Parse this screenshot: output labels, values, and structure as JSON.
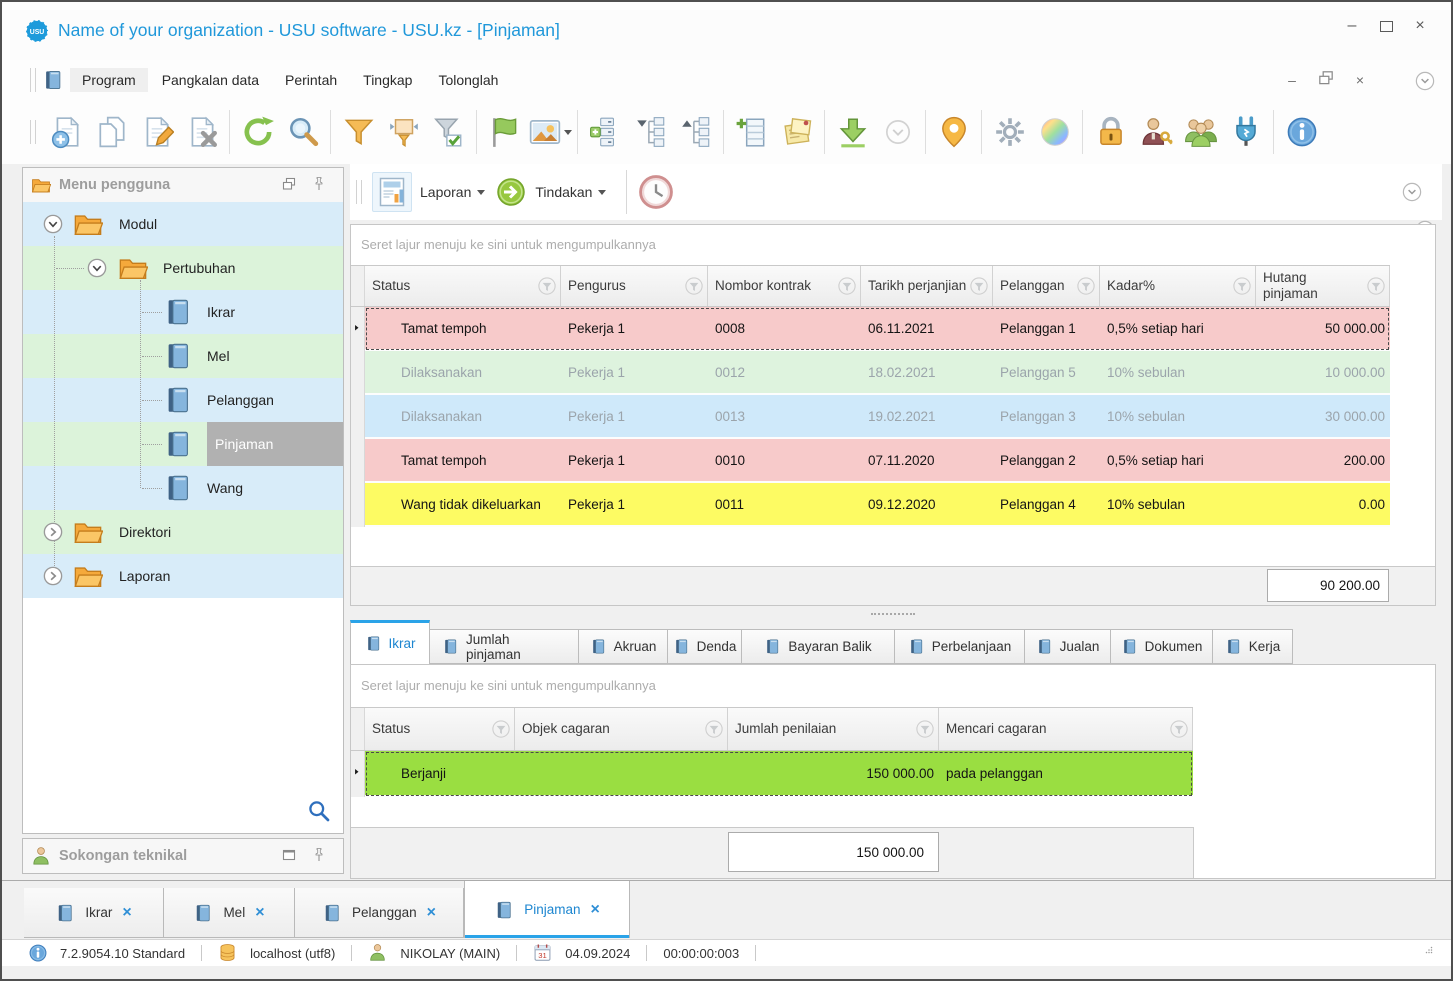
{
  "window": {
    "title": "Name of your organization - USU software - USU.kz - [Pinjaman]",
    "logo_text": "USU",
    "controls": {
      "minimize": "–",
      "close": "×"
    }
  },
  "menu_bar": {
    "active_item": "Program",
    "items": [
      "Program",
      "Pangkalan data",
      "Perintah",
      "Tingkap",
      "Tolonglah"
    ]
  },
  "toolbar": {
    "buttons": [
      "add-record",
      "copy-record",
      "edit-record",
      "delete-record",
      "|",
      "refresh",
      "search",
      "|",
      "filter",
      "filter-custom",
      "filter-checked",
      "|",
      "flag",
      "image+",
      "|",
      "expand-groups",
      "collapse-tree",
      "expand-tree",
      "|",
      "add-column",
      "notes",
      "|",
      "export",
      "chevron-mini",
      "|",
      "location",
      "|",
      "settings",
      "palette",
      "|",
      "lock",
      "user-key",
      "users",
      "plug",
      "|",
      "info"
    ]
  },
  "actions_bar": {
    "report_label": "Laporan",
    "action_label": "Tindakan"
  },
  "sidebar": {
    "title": "Menu pengguna",
    "support_title": "Sokongan teknikal",
    "tree": [
      {
        "label": "Modul",
        "level": 0,
        "icon": "folder",
        "expander": "down"
      },
      {
        "label": "Pertubuhan",
        "level": 1,
        "icon": "folder",
        "expander": "down"
      },
      {
        "label": "Ikrar",
        "level": 2,
        "icon": "book"
      },
      {
        "label": "Mel",
        "level": 2,
        "icon": "book"
      },
      {
        "label": "Pelanggan",
        "level": 2,
        "icon": "book"
      },
      {
        "label": "Pinjaman",
        "level": 2,
        "icon": "book",
        "selected": true
      },
      {
        "label": "Wang",
        "level": 2,
        "icon": "book"
      },
      {
        "label": "Direktori",
        "level": 0,
        "icon": "folder",
        "expander": "right"
      },
      {
        "label": "Laporan",
        "level": 0,
        "icon": "folder",
        "expander": "right"
      }
    ]
  },
  "main_grid": {
    "group_panel_text": "Seret lajur menuju ke sini untuk mengumpulkannya",
    "columns": [
      "Status",
      "Pengurus",
      "Nombor kontrak",
      "Tarikh perjanjian",
      "Pelanggan",
      "Kadar%",
      "Hutang pinjaman"
    ],
    "rows": [
      {
        "cells": [
          "Tamat tempoh",
          "Pekerja 1",
          "0008",
          "06.11.2021",
          "Pelanggan 1",
          "0,5% setiap hari",
          "50 000.00"
        ],
        "color": "pink",
        "focused": true
      },
      {
        "cells": [
          "Dilaksanakan",
          "Pekerja 1",
          "0012",
          "18.02.2021",
          "Pelanggan 5",
          "10% sebulan",
          "10 000.00"
        ],
        "color": "green",
        "muted": true
      },
      {
        "cells": [
          "Dilaksanakan",
          "Pekerja 1",
          "0013",
          "19.02.2021",
          "Pelanggan 3",
          "10% sebulan",
          "30 000.00"
        ],
        "color": "blue",
        "muted": true
      },
      {
        "cells": [
          "Tamat tempoh",
          "Pekerja 1",
          "0010",
          "07.11.2020",
          "Pelanggan 2",
          "0,5% setiap hari",
          "200.00"
        ],
        "color": "pink"
      },
      {
        "cells": [
          "Wang tidak dikeluarkan",
          "Pekerja 1",
          "0011",
          "09.12.2020",
          "Pelanggan 4",
          "10% sebulan",
          "0.00"
        ],
        "color": "yellow"
      }
    ],
    "summary": "90 200.00"
  },
  "detail_tabs": {
    "active": "Ikrar",
    "tabs": [
      "Ikrar",
      "Jumlah pinjaman",
      "Akruan",
      "Denda",
      "Bayaran Balik",
      "Perbelanjaan",
      "Jualan",
      "Dokumen",
      "Kerja"
    ]
  },
  "detail_grid": {
    "group_panel_text": "Seret lajur menuju ke sini untuk mengumpulkannya",
    "columns": [
      "Status",
      "Objek cagaran",
      "Jumlah penilaian",
      "Mencari cagaran"
    ],
    "rows": [
      {
        "cells": [
          "Berjanji",
          "",
          "150 000.00",
          "pada pelanggan"
        ],
        "color": "lime",
        "focused": true
      }
    ],
    "summary": "150 000.00"
  },
  "doc_tabs": {
    "active": "Pinjaman",
    "close_glyph": "×",
    "tabs": [
      "Ikrar",
      "Mel",
      "Pelanggan",
      "Pinjaman"
    ]
  },
  "status_bar": {
    "version": "7.2.9054.10 Standard",
    "database": "localhost (utf8)",
    "user": "NIKOLAY (MAIN)",
    "calendar_day": "31",
    "date": "04.09.2024",
    "timer": "00:00:00:003"
  }
}
